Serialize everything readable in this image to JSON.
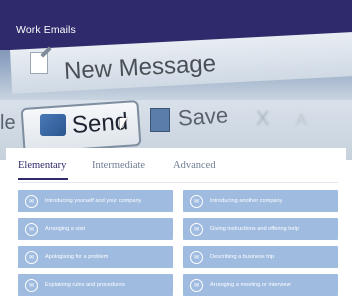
{
  "app": {
    "title": "Work Emails"
  },
  "hero_image": {
    "new_message": "New Message",
    "send": "Send",
    "save": "Save",
    "left_fragment": "le",
    "blurred_1": "X",
    "blurred_2": "A"
  },
  "tabs": [
    {
      "label": "Elementary",
      "active": true
    },
    {
      "label": "Intermediate",
      "active": false
    },
    {
      "label": "Advanced",
      "active": false
    }
  ],
  "lessons": [
    {
      "label": "Introducing yourself and your company",
      "icon": "mail-icon"
    },
    {
      "label": "Introducing another company",
      "icon": "mail-icon"
    },
    {
      "label": "Arranging a visit",
      "icon": "mail-icon"
    },
    {
      "label": "Giving instructions and offering help",
      "icon": "mail-icon"
    },
    {
      "label": "Apologising for a problem",
      "icon": "mail-icon"
    },
    {
      "label": "Describing a business trip",
      "icon": "mail-icon"
    },
    {
      "label": "Explaining rules and procedures",
      "icon": "mail-icon"
    },
    {
      "label": "Arranging a meeting or interview",
      "icon": "mail-icon"
    }
  ],
  "colors": {
    "title_bar": "#2f2a6b",
    "lesson_bg": "#9fbbe0",
    "tab_active": "#2f2a6b",
    "tab_inactive": "#6d7e93"
  }
}
